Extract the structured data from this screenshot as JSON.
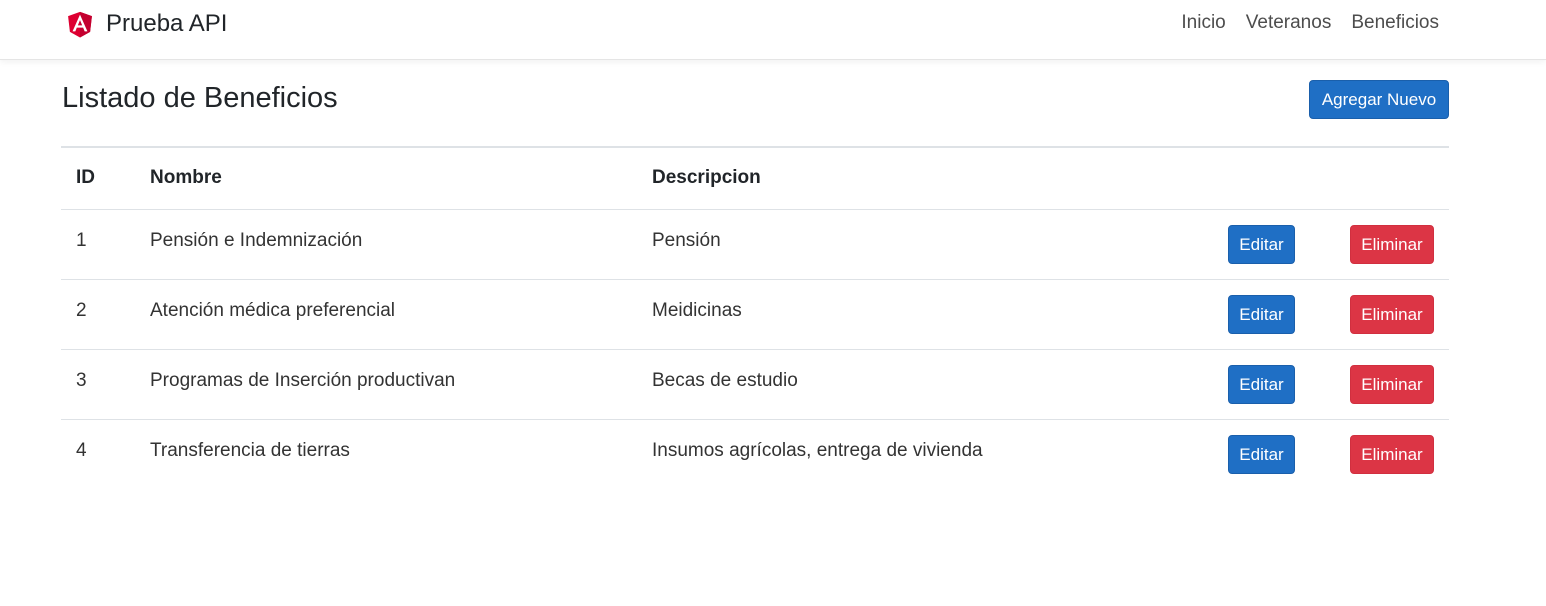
{
  "navbar": {
    "brand_text": "Prueba API",
    "brand_icon": "angular-logo-icon",
    "links": [
      "Inicio",
      "Veteranos",
      "Beneficios"
    ]
  },
  "page": {
    "title": "Listado de Beneficios",
    "add_button_label": "Agregar Nuevo"
  },
  "table": {
    "headers": {
      "id": "ID",
      "nombre": "Nombre",
      "descripcion": "Descripcion"
    },
    "rows": [
      {
        "id": "1",
        "nombre": "Pensión e Indemnización",
        "descripcion": "Pensión",
        "edit_label": "Editar",
        "delete_label": "Eliminar"
      },
      {
        "id": "2",
        "nombre": "Atención médica preferencial",
        "descripcion": "Meidicinas",
        "edit_label": "Editar",
        "delete_label": "Eliminar"
      },
      {
        "id": "3",
        "nombre": "Programas de Inserción productivan",
        "descripcion": "Becas de estudio",
        "edit_label": "Editar",
        "delete_label": "Eliminar"
      },
      {
        "id": "4",
        "nombre": "Transferencia de tierras",
        "descripcion": "Insumos agrícolas, entrega de vivienda",
        "edit_label": "Editar",
        "delete_label": "Eliminar"
      }
    ]
  },
  "colors": {
    "primary": "#1f6fc5",
    "danger": "#dc3545",
    "angular_red": "#dd0031"
  }
}
